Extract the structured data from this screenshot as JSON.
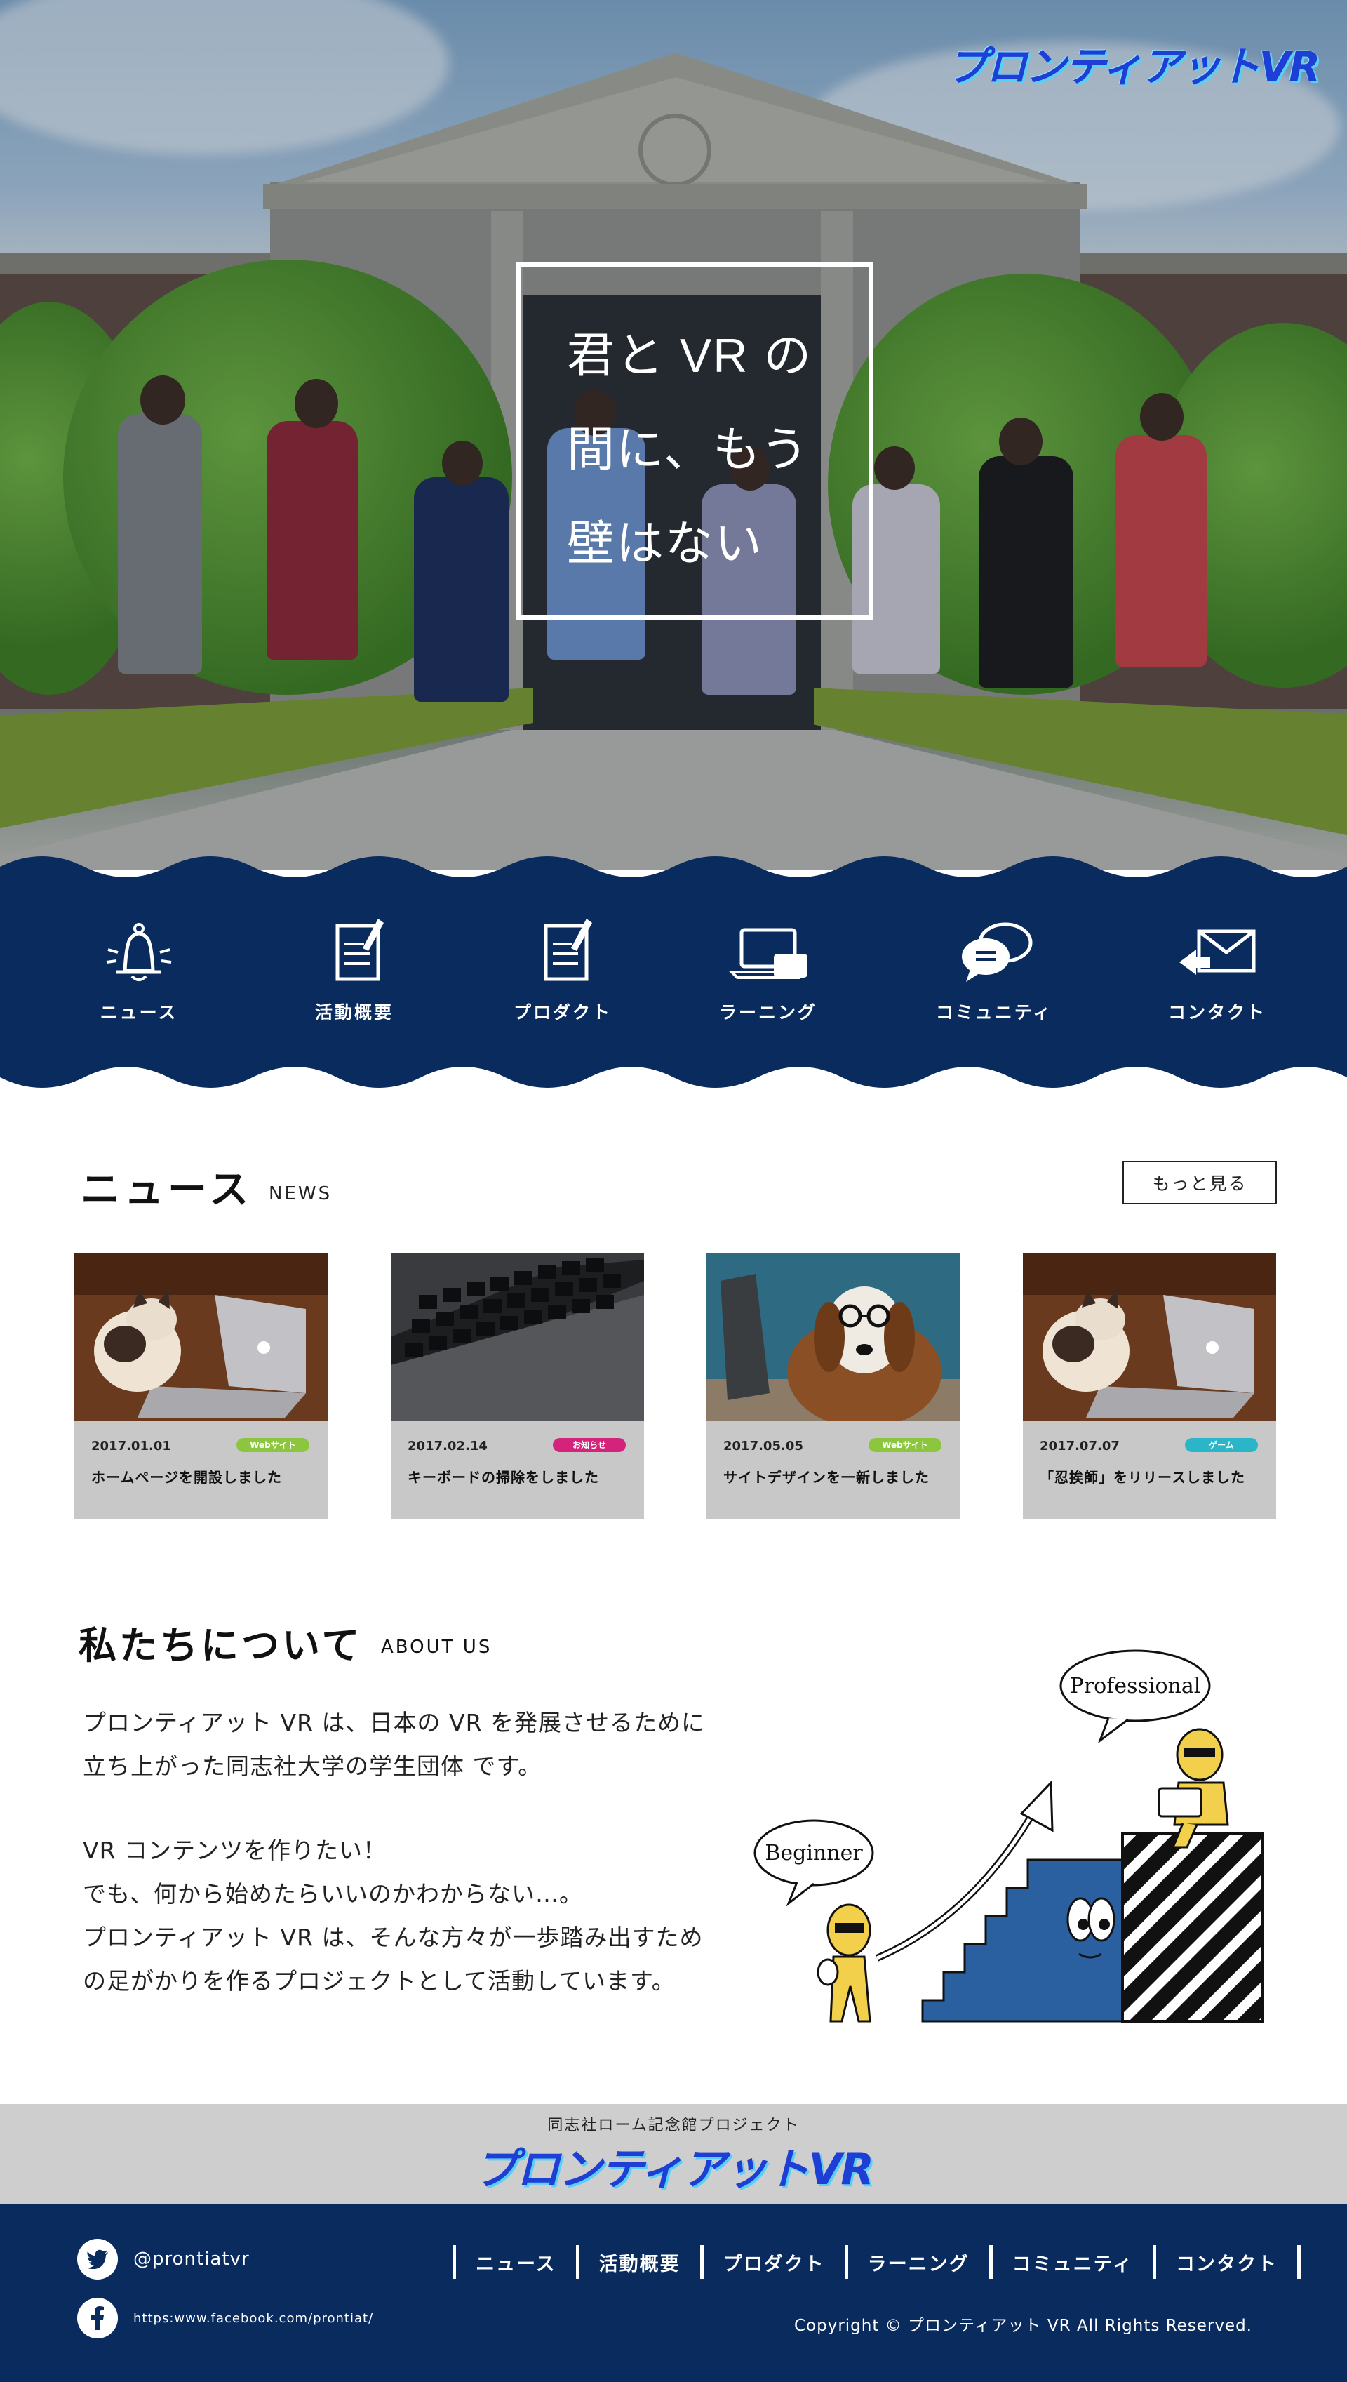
{
  "brand": {
    "logo_text": "プロンティアットVR"
  },
  "hero": {
    "copy_lines": [
      "君と VR の",
      "間に、もう",
      "壁はない"
    ]
  },
  "nav": {
    "items": [
      {
        "label": "ニュース",
        "icon": "bell-icon"
      },
      {
        "label": "活動概要",
        "icon": "document-pen-icon"
      },
      {
        "label": "プロダクト",
        "icon": "document-pen-icon"
      },
      {
        "label": "ラーニング",
        "icon": "laptop-icon"
      },
      {
        "label": "コミュニティ",
        "icon": "chat-bubbles-icon"
      },
      {
        "label": "コンタクト",
        "icon": "envelope-icon"
      }
    ],
    "band_color": "#0a2b5e"
  },
  "news": {
    "title": "ニュース",
    "subtitle": "NEWS",
    "more_label": "もっと見る",
    "cards": [
      {
        "date": "2017.01.01",
        "tag": "Webサイト",
        "tag_color": "#8cc63f",
        "title": "ホームページを開設しました",
        "image": "cat-with-laptop"
      },
      {
        "date": "2017.02.14",
        "tag": "お知らせ",
        "tag_color": "#d4237a",
        "title": "キーボードの掃除をしました",
        "image": "keyboard"
      },
      {
        "date": "2017.05.05",
        "tag": "Webサイト",
        "tag_color": "#8cc63f",
        "title": "サイトデザインを一新しました",
        "image": "dog-with-laptop"
      },
      {
        "date": "2017.07.07",
        "tag": "ゲーム",
        "tag_color": "#2bb5c8",
        "title": "「忍挨師」をリリースしました",
        "image": "cat-with-laptop"
      }
    ]
  },
  "about": {
    "title": "私たちについて",
    "subtitle": "ABOUT US",
    "paragraph1": [
      "プロンティアット VR は、日本の VR を発展させるために",
      "立ち上がった同志社大学の学生団体 です。"
    ],
    "paragraph2": [
      "VR コンテンツを作りたい！",
      "でも、何から始めたらいいのかわからない…。",
      "プロンティアット VR は、そんな方々が一歩踏み出すため",
      "の足がかりを作るプロジェクトとして活動しています。"
    ],
    "illustration": {
      "bubble_left": "Beginner",
      "bubble_right": "Professional"
    }
  },
  "footer": {
    "project_label": "同志社ローム記念館プロジェクト",
    "logo_text": "プロンティアットVR",
    "twitter": "@prontiatvr",
    "facebook": "https:www.facebook.com/prontiat/",
    "nav": [
      "ニュース",
      "活動概要",
      "プロダクト",
      "ラーニング",
      "コミュニティ",
      "コンタクト"
    ],
    "copyright": "Copyright © プロンティアット VR All Rights Reserved."
  }
}
